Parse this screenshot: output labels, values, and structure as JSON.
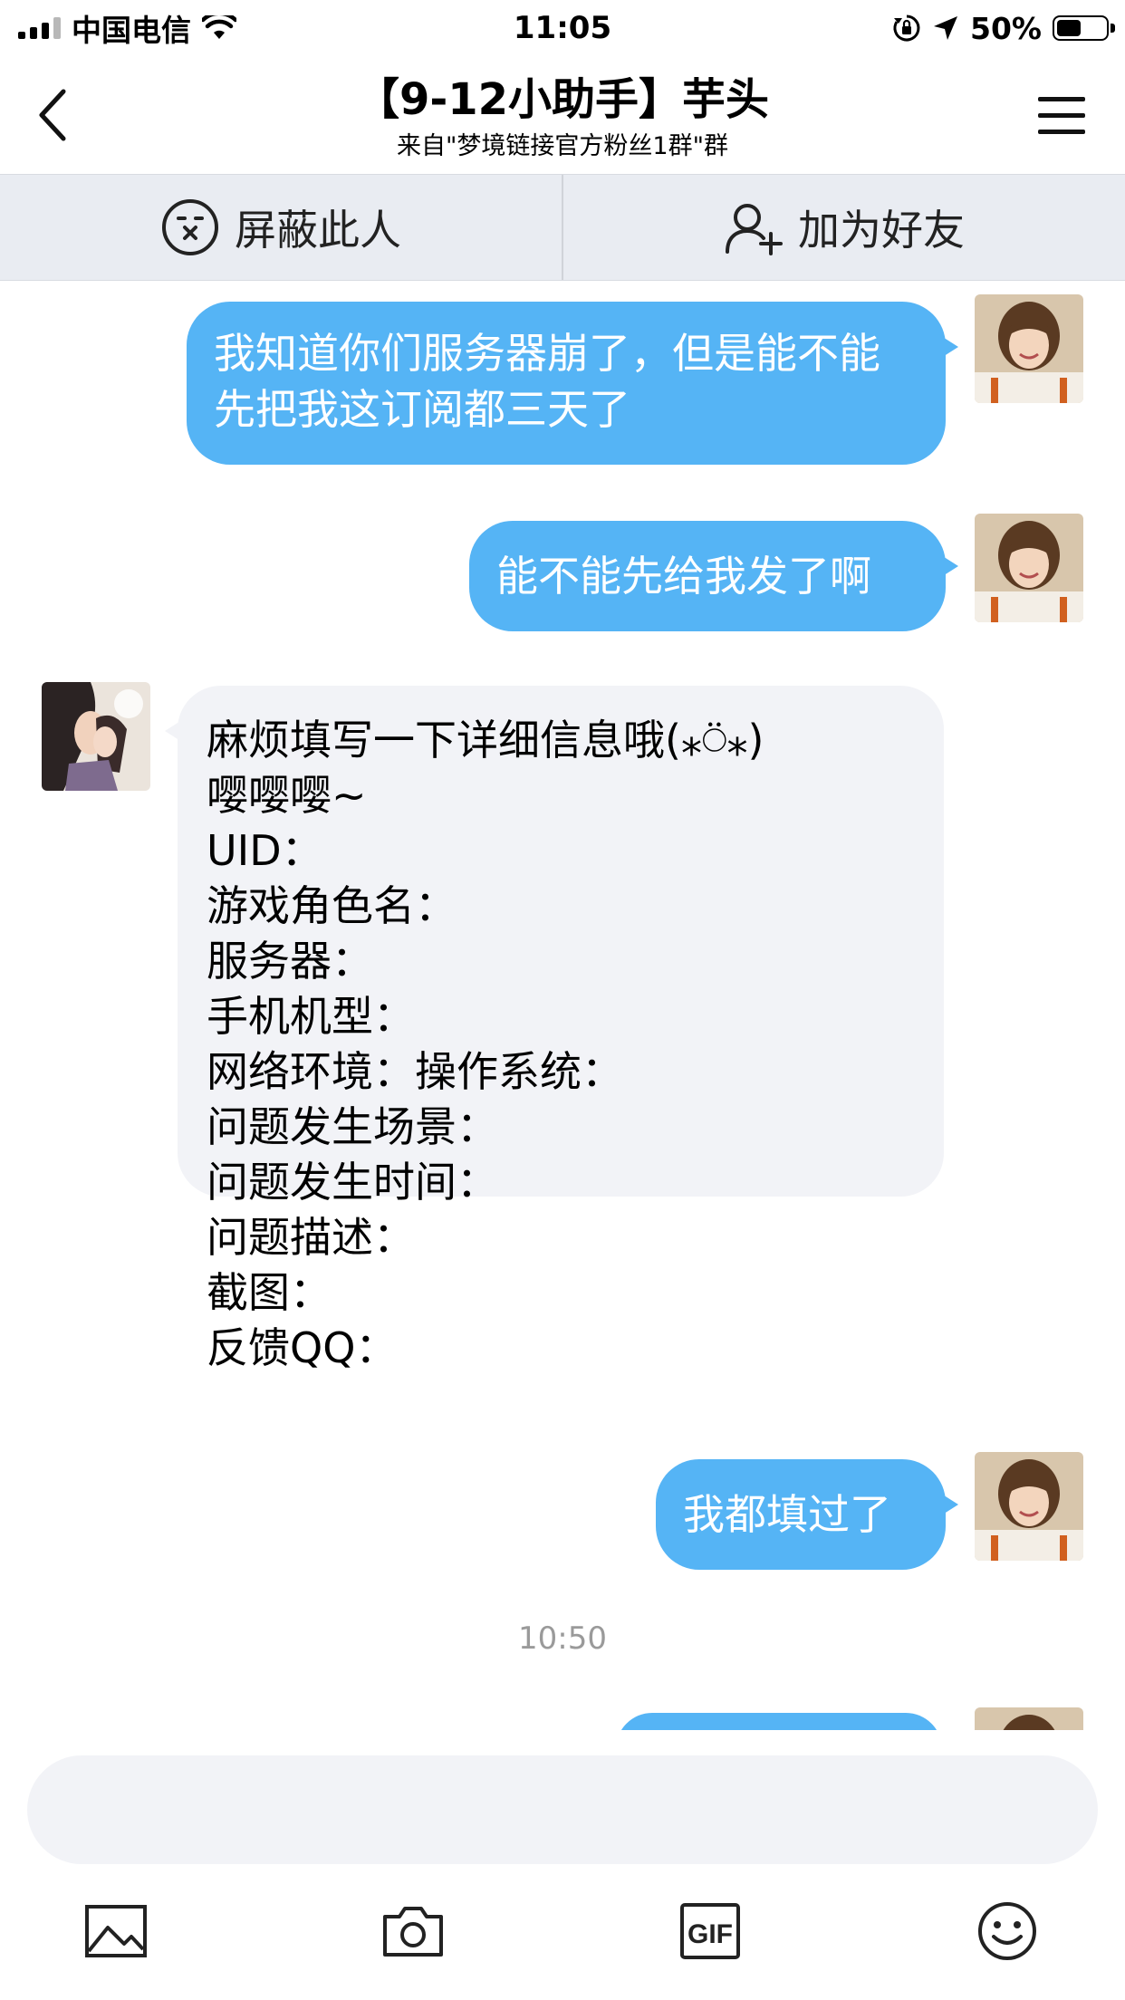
{
  "status_bar": {
    "carrier": "中国电信",
    "time": "11:05",
    "battery_percent": "50%",
    "battery_level": 0.5
  },
  "nav": {
    "title": "【9-12小助手】芋头",
    "subtitle": "来自\"梦境链接官方粉丝1群\"群"
  },
  "actions": {
    "block_label": "屏蔽此人",
    "add_friend_label": "加为好友"
  },
  "messages": [
    {
      "direction": "out",
      "text": "我知道你们服务器崩了，但是能不能先把我这订阅都三天了"
    },
    {
      "direction": "out",
      "text": "能不能先给我发了啊"
    },
    {
      "direction": "in",
      "lines": [
        "麻烦填写一下详细信息哦(⁎⍥⁎)",
        "嘤嘤嘤~",
        "UID：",
        "游戏角色名：",
        "服务器：",
        "手机机型：",
        "网络环境：操作系统：",
        "问题发生场景：",
        "问题发生时间：",
        "问题描述：",
        "截图：",
        "反馈QQ："
      ]
    },
    {
      "direction": "out",
      "text": "我都填过了"
    }
  ],
  "timestamp": "10:50",
  "input": {
    "placeholder": ""
  },
  "toolbar": {
    "items": [
      "image-icon",
      "camera-icon",
      "gif-icon",
      "emoji-icon"
    ],
    "gif_label": "GIF"
  },
  "colors": {
    "outgoing_bubble": "#55b4f5",
    "incoming_bubble": "#f2f3f7",
    "action_bar": "#e9ecf2"
  }
}
